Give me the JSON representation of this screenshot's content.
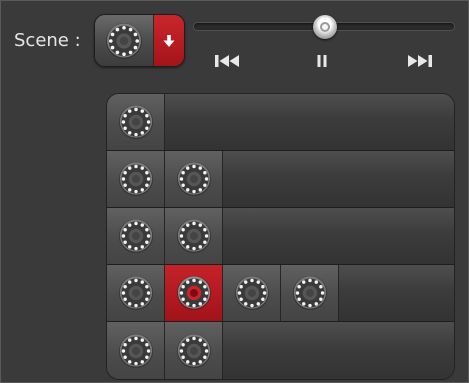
{
  "scene": {
    "label": "Scene :",
    "icon": "scene-ring-icon"
  },
  "slider": {
    "position_fraction": 0.5
  },
  "transport": {
    "previous_icon": "skip-previous-icon",
    "pause_icon": "pause-icon",
    "next_icon": "skip-next-icon"
  },
  "grid": {
    "rows": [
      {
        "cells": [
          {
            "active": false
          }
        ]
      },
      {
        "cells": [
          {
            "active": false
          },
          {
            "active": false
          }
        ]
      },
      {
        "cells": [
          {
            "active": false
          },
          {
            "active": false
          }
        ]
      },
      {
        "cells": [
          {
            "active": false
          },
          {
            "active": true
          },
          {
            "active": false
          },
          {
            "active": false
          }
        ]
      },
      {
        "cells": [
          {
            "active": false
          },
          {
            "active": false
          }
        ]
      }
    ]
  },
  "colors": {
    "accent": "#b51b21",
    "background": "#3a3a3a",
    "text": "#e6e6e6"
  }
}
